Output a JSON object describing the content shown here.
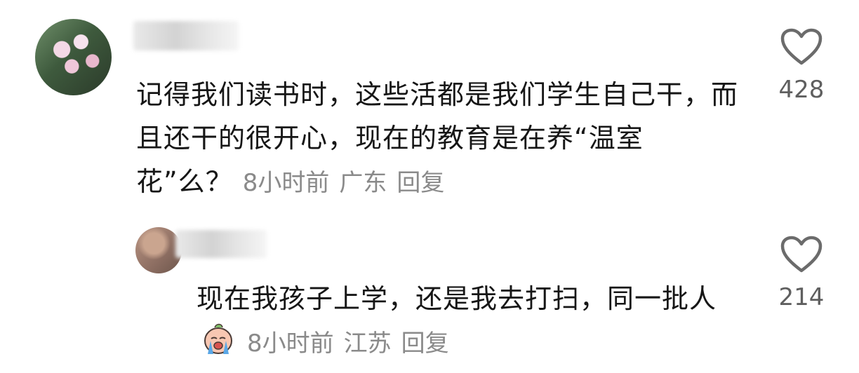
{
  "comments": [
    {
      "text": "记得我们读书时，这些活都是我们学生自己干，而且还干的很开心，现在的教育是在养“温室花”么？",
      "time": "8小时前",
      "location": "广东",
      "reply_label": "回复",
      "like_icon": "heart-outline-icon",
      "likes": "428"
    },
    {
      "text": "现在我孩子上学，还是我去打扫，同一批人",
      "emoji": "crying-face-emoji",
      "time": "8小时前",
      "location": "江苏",
      "reply_label": "回复",
      "like_icon": "heart-outline-icon",
      "likes": "214"
    }
  ]
}
